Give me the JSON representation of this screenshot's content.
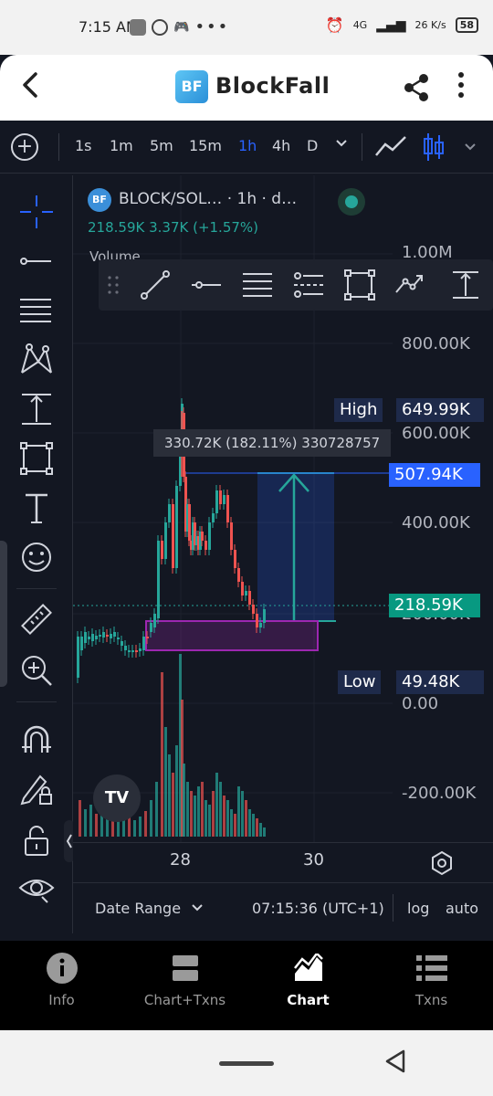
{
  "status_bar": {
    "time": "7:15 AM",
    "network": "4G",
    "speed": "26 K/s",
    "battery": "58"
  },
  "app_bar": {
    "logo_text": "BF",
    "title": "BlockFall"
  },
  "toolbar": {
    "intervals": [
      "1s",
      "1m",
      "5m",
      "15m",
      "1h",
      "4h",
      "D"
    ],
    "active_interval": "1h"
  },
  "chart": {
    "logo_text": "BF",
    "title": "BLOCK/SOL… · 1h · d…",
    "legend_values": "218.59K  3.37K (+1.57%)",
    "volume_label": "Volume",
    "price_scale": [
      "1.00M",
      "800.00K",
      "600.00K",
      "400.00K",
      "200.00K",
      "0.00",
      "-200.00K"
    ],
    "high_label": "High",
    "high_value": "649.99K",
    "target_value": "507.94K",
    "current_value": "218.59K",
    "low_label": "Low",
    "low_value": "49.48K",
    "measure_text": "330.72K (182.11%) 330728757",
    "time_labels": [
      "28",
      "30"
    ],
    "accent_colors": {
      "up": "#26a69a",
      "down": "#ef5350",
      "highlight": "#2962ff",
      "zone": "#9c27b0"
    }
  },
  "range_bar": {
    "date_range": "Date Range",
    "clock": "07:15:36 (UTC+1)",
    "log": "log",
    "auto": "auto"
  },
  "bottom_nav": {
    "items": [
      {
        "label": "Info",
        "icon": "info-icon"
      },
      {
        "label": "Chart+Txns",
        "icon": "split-view-icon"
      },
      {
        "label": "Chart",
        "icon": "area-chart-icon"
      },
      {
        "label": "Txns",
        "icon": "list-icon"
      }
    ],
    "active": "Chart"
  }
}
